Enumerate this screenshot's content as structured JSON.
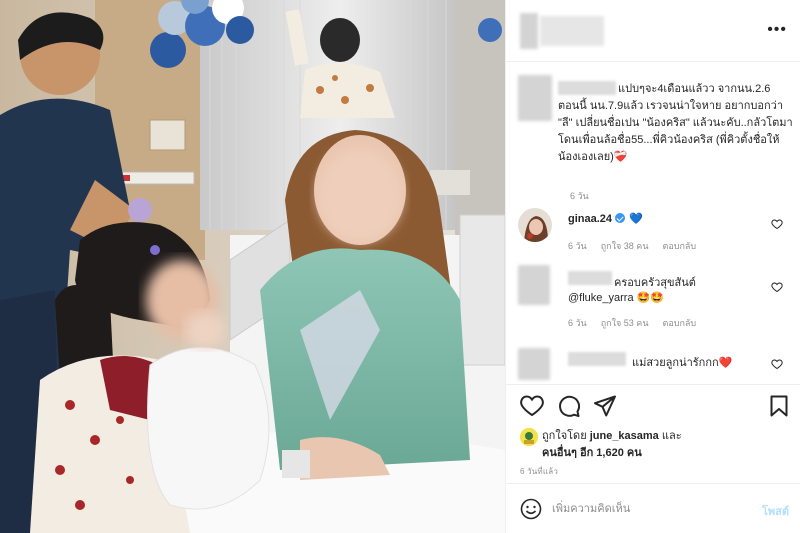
{
  "post": {
    "caption": "แปบๆจะ4เดือนแล้วว จากนน.2.6 ตอนนี้ นน.7.9แล้ว เรวจนน่าใจหาย อยากบอกว่า \"ลี\" เปลี่ยนชื่อเปน \"น้องคริส\" แล้วนะคับ..กลัวโตมาโดนเพื่อนล้อชื่อ55...พี่คิวน้องคริส (พี่คิวตั้งชื่อให้น้องเองเลย)",
    "caption_emoji": "❤️‍🩹",
    "caption_time": "6 วัน"
  },
  "comments": [
    {
      "username": "ginaa.24",
      "verified": true,
      "text": "💙",
      "time": "6 วัน",
      "likes": "ถูกใจ 38 คน",
      "reply": "ตอบกลับ"
    },
    {
      "username": "",
      "text": "ครอบครัวสุขสันต์",
      "text2": "@fluke_yarra 🤩🤩",
      "time": "6 วัน",
      "likes": "ถูกใจ 53 คน",
      "reply": "ตอบกลับ"
    },
    {
      "username": "",
      "text": "แม่สวยลูกน่ารักกก❤️"
    }
  ],
  "likes": {
    "prefix": "ถูกใจโดย",
    "user": "june_kasama",
    "and": "และ",
    "others": "คนอื่นๆ อีก 1,620 คน"
  },
  "post_time": "6 วันที่แล้ว",
  "add_comment": {
    "placeholder": "เพิ่มความคิดเห็น",
    "post_label": "โพสต์"
  },
  "icons": {
    "more": "more-options-icon",
    "like": "heart-icon",
    "comment": "comment-icon",
    "share": "share-icon",
    "save": "bookmark-icon",
    "emoji": "emoji-icon"
  },
  "colors": {
    "accent": "#3897f0",
    "post_disabled": "#b2dffc",
    "heart": "#e0245e"
  }
}
